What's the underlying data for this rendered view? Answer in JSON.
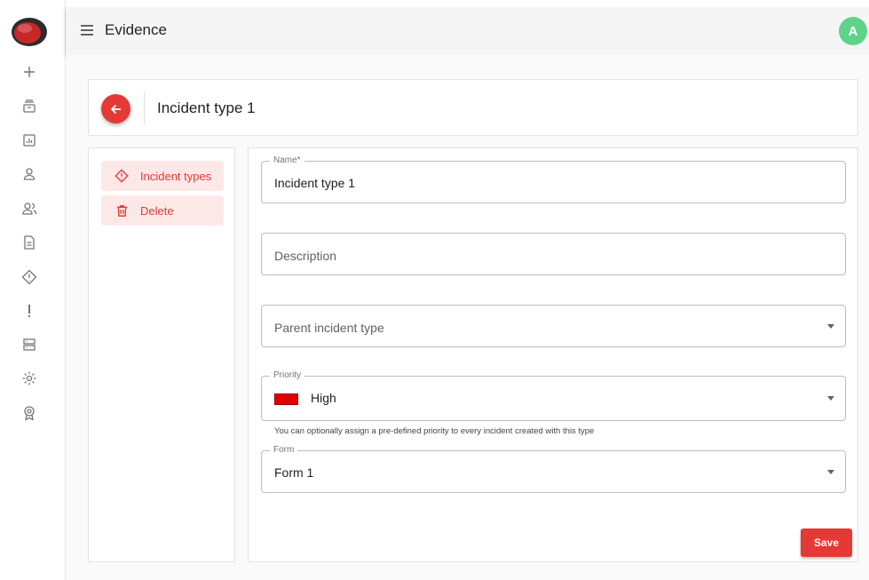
{
  "app": {
    "title": "Evidence",
    "avatar_initial": "A"
  },
  "rail": {
    "items": [
      {
        "icon": "plus-icon"
      },
      {
        "icon": "archive-icon"
      },
      {
        "icon": "report-icon"
      },
      {
        "icon": "user-icon"
      },
      {
        "icon": "users-icon"
      },
      {
        "icon": "document-icon"
      },
      {
        "icon": "warning-diamond-icon"
      },
      {
        "icon": "exclamation-icon"
      },
      {
        "icon": "server-icon"
      },
      {
        "icon": "gear-icon"
      },
      {
        "icon": "badge-icon"
      }
    ]
  },
  "header": {
    "title": "Incident type 1"
  },
  "side_nav": {
    "items": [
      {
        "label": "Incident types",
        "icon": "warning-diamond-icon"
      },
      {
        "label": "Delete",
        "icon": "trash-icon"
      }
    ]
  },
  "form": {
    "name": {
      "label": "Name*",
      "value": "Incident type 1"
    },
    "description": {
      "placeholder": "Description"
    },
    "parent": {
      "placeholder": "Parent incident type"
    },
    "priority": {
      "label": "Priority",
      "value": "High",
      "color": "#e00000",
      "helper": "You can optionally assign a pre-defined priority to every incident created with this type"
    },
    "form_select": {
      "label": "Form",
      "value": "Form 1"
    },
    "save_label": "Save"
  },
  "colors": {
    "accent": "#e53935",
    "avatar": "#5fd38a",
    "priority_high": "#e00000"
  }
}
